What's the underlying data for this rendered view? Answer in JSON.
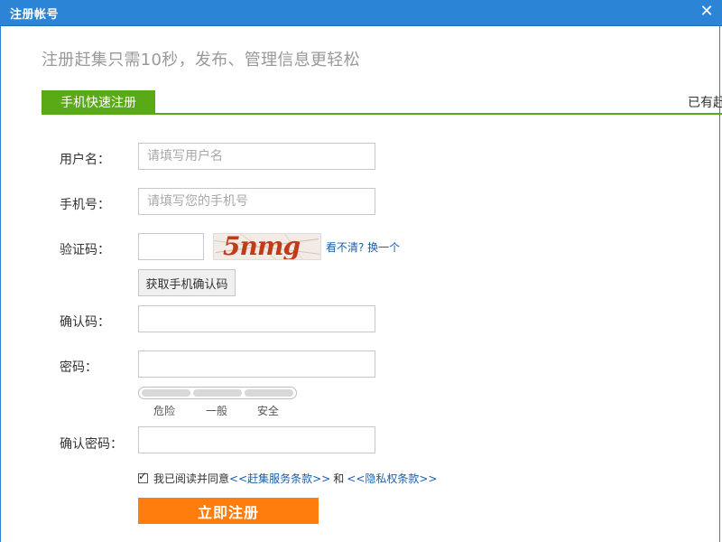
{
  "window": {
    "title": "注册帐号",
    "close_glyph": "✕"
  },
  "subtitle": "注册赶集只需10秒，发布、管理信息更轻松",
  "tab": {
    "label": "手机快速注册"
  },
  "login_prompt": "已有赶",
  "form": {
    "username": {
      "label": "用户名：",
      "placeholder": "请填写用户名",
      "value": ""
    },
    "phone": {
      "label": "手机号：",
      "placeholder": "请填写您的手机号",
      "value": ""
    },
    "captcha": {
      "label": "验证码：",
      "value": "",
      "image_text": "5nmg",
      "refresh_link": "看不清? 换一个"
    },
    "sms_button": "获取手机确认码",
    "confirm_code": {
      "label": "确认码：",
      "value": ""
    },
    "password": {
      "label": "密码：",
      "value": ""
    },
    "strength": {
      "levels": [
        "危险",
        "一般",
        "安全"
      ],
      "current_level": 0
    },
    "confirm_password": {
      "label": "确认密码：",
      "value": ""
    },
    "agreement": {
      "checked": true,
      "text": "我已阅读并同意",
      "service_link": "<<赶集服务条款>>",
      "and": "和",
      "privacy_link": "<<隐私权条款>>"
    },
    "submit_label": "立即注册"
  },
  "colors": {
    "titlebar": "#2b84d6",
    "tab_green": "#5aaa15",
    "submit_orange": "#ff7d0c",
    "link_blue": "#1a5fa8"
  },
  "icons": {
    "close": "close-icon",
    "checkbox": "checkbox-checked-icon"
  }
}
